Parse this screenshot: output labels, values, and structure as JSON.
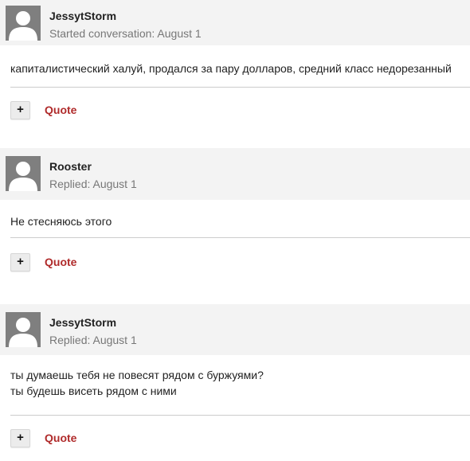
{
  "posts": [
    {
      "author": "JessytStorm",
      "meta": "Started conversation: August 1",
      "lines": [
        "капиталистический халуй, продался за пару долларов, средний класс недорезанный"
      ],
      "plus_label": "+",
      "quote_label": "Quote"
    },
    {
      "author": "Rooster",
      "meta": "Replied: August 1",
      "lines": [
        "Не стесняюсь этого"
      ],
      "plus_label": "+",
      "quote_label": "Quote"
    },
    {
      "author": "JessytStorm",
      "meta": "Replied: August 1",
      "lines": [
        "ты думаешь тебя не повесят рядом с буржуями?",
        "ты будешь висеть рядом с ними"
      ],
      "plus_label": "+",
      "quote_label": "Quote"
    }
  ],
  "icons": {
    "avatar": "default-user-silhouette-icon"
  },
  "colors": {
    "quote_link": "#b02b2b",
    "header_bg": "#f3f3f3",
    "avatar_bg": "#7f7f7f"
  }
}
